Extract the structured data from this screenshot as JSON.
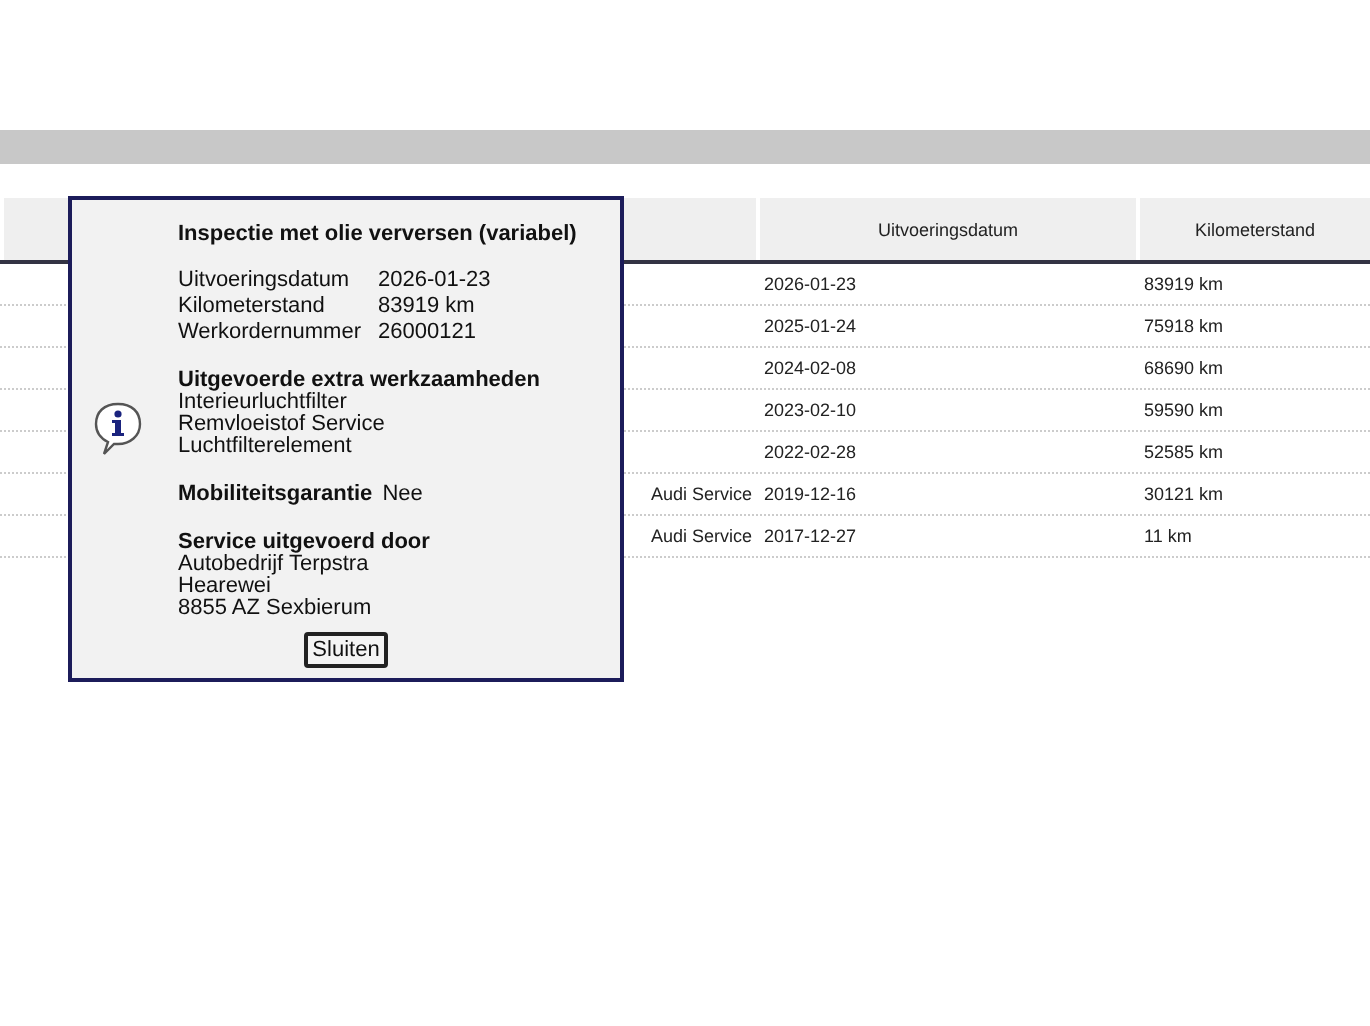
{
  "table": {
    "columns": [
      "Uitvoeringsdatum",
      "Kilometerstand"
    ],
    "rows": [
      {
        "date": "2026-01-23",
        "mileage": "83919 km"
      },
      {
        "date": "2025-01-24",
        "mileage": "75918 km"
      },
      {
        "date": "2024-02-08",
        "mileage": "68690 km"
      },
      {
        "date": "2023-02-10",
        "mileage": "59590 km"
      },
      {
        "date": "2022-02-28",
        "mileage": "52585 km"
      },
      {
        "column_1": "Audi Service",
        "date": "2019-12-16",
        "mileage": "30121 km"
      },
      {
        "column_1": "Audi Service",
        "date": "2017-12-27",
        "mileage": "11 km"
      }
    ]
  },
  "dialog": {
    "title": "Inspectie met olie verversen (variabel)",
    "fields": [
      {
        "label": "Uitvoeringsdatum",
        "value": "2026-01-23"
      },
      {
        "label": "Kilometerstand",
        "value": "83919 km"
      },
      {
        "label": "Werkordernummer",
        "value": "26000121"
      }
    ],
    "extra_heading": "Uitgevoerde extra werkzaamheden",
    "extra_items": [
      "Interieurluchtfilter",
      "Remvloeistof Service",
      "Luchtfilterelement"
    ],
    "mobility_label": "Mobiliteitsgarantie",
    "mobility_value": "Nee",
    "service_heading": "Service uitgevoerd door",
    "service_lines": [
      "Autobedrijf Terpstra",
      "Hearewei",
      "8855 AZ Sexbierum"
    ],
    "close_button": "Sluiten"
  }
}
